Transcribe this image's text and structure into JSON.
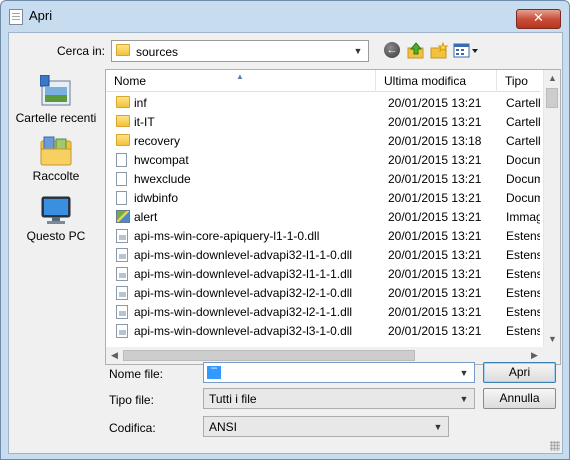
{
  "window": {
    "title": "Apri",
    "close_glyph": "✕"
  },
  "toolbar": {
    "look_in_label": "Cerca in:",
    "look_in_value": "sources",
    "icons": [
      "back-icon",
      "up-folder-icon",
      "new-folder-icon",
      "views-menu-icon"
    ]
  },
  "places": [
    {
      "label": "Cartelle recenti",
      "icon": "recent-places-icon"
    },
    {
      "label": "Raccolte",
      "icon": "libraries-icon"
    },
    {
      "label": "Questo PC",
      "icon": "computer-icon"
    }
  ],
  "columns": {
    "name": "Nome",
    "modified": "Ultima modifica",
    "type": "Tipo"
  },
  "files": [
    {
      "name": "inf",
      "modified": "20/01/2015 13:21",
      "type": "Cartell",
      "icon": "folder"
    },
    {
      "name": "it-IT",
      "modified": "20/01/2015 13:21",
      "type": "Cartell",
      "icon": "folder"
    },
    {
      "name": "recovery",
      "modified": "20/01/2015 13:18",
      "type": "Cartell",
      "icon": "folder"
    },
    {
      "name": "hwcompat",
      "modified": "20/01/2015 13:21",
      "type": "Docum",
      "icon": "document"
    },
    {
      "name": "hwexclude",
      "modified": "20/01/2015 13:21",
      "type": "Docum",
      "icon": "document"
    },
    {
      "name": "idwbinfo",
      "modified": "20/01/2015 13:21",
      "type": "Docum",
      "icon": "document"
    },
    {
      "name": "alert",
      "modified": "20/01/2015 13:21",
      "type": "Immag",
      "icon": "image"
    },
    {
      "name": "api-ms-win-core-apiquery-l1-1-0.dll",
      "modified": "20/01/2015 13:21",
      "type": "Estensi",
      "icon": "dll"
    },
    {
      "name": "api-ms-win-downlevel-advapi32-l1-1-0.dll",
      "modified": "20/01/2015 13:21",
      "type": "Estensi",
      "icon": "dll"
    },
    {
      "name": "api-ms-win-downlevel-advapi32-l1-1-1.dll",
      "modified": "20/01/2015 13:21",
      "type": "Estensi",
      "icon": "dll"
    },
    {
      "name": "api-ms-win-downlevel-advapi32-l2-1-0.dll",
      "modified": "20/01/2015 13:21",
      "type": "Estensi",
      "icon": "dll"
    },
    {
      "name": "api-ms-win-downlevel-advapi32-l2-1-1.dll",
      "modified": "20/01/2015 13:21",
      "type": "Estensi",
      "icon": "dll"
    },
    {
      "name": "api-ms-win-downlevel-advapi32-l3-1-0.dll",
      "modified": "20/01/2015 13:21",
      "type": "Estensi",
      "icon": "dll"
    }
  ],
  "form": {
    "filename_label": "Nome file:",
    "filename_value": "",
    "filetype_label": "Tipo file:",
    "filetype_value": "Tutti i file",
    "encoding_label": "Codifica:",
    "encoding_value": "ANSI",
    "open_button": "Apri",
    "cancel_button": "Annulla"
  },
  "colors": {
    "title_bar": "#c8dcf0",
    "close_button": "#c7503c",
    "selection": "#3399ff"
  }
}
